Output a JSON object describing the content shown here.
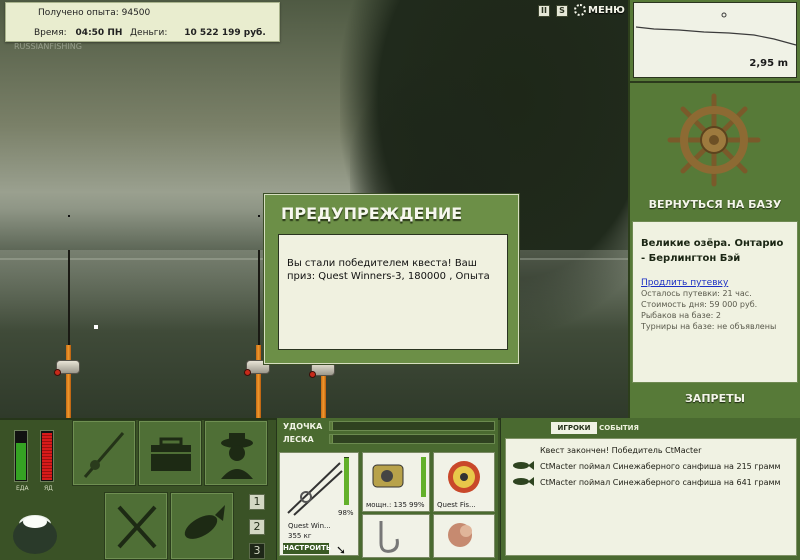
{
  "info": {
    "experience_label": "Получено опыта:",
    "experience_value": "94500",
    "time_label": "Время:",
    "time_value": "04:50 ПН",
    "money_label": "Деньги:",
    "money_value": "10 522 199 руб.",
    "logo_text": "RUSSIANFISHING"
  },
  "top_buttons": {
    "pause": "II",
    "sound": "S",
    "menu": "МЕНЮ"
  },
  "depth": {
    "value": "2,95 m"
  },
  "base": {
    "return_label": "ВЕРНУТЬСЯ НА БАЗУ",
    "location_title": "Великие озёра. Онтарио - Берлингтон Бэй",
    "extend_link": "Продлить путевку",
    "lines": [
      "Осталось путевки: 21 час.",
      "Стоимость дня: 59 000 руб.",
      "Рыбаков на базе: 2",
      "Турниры на базе: не объявлены"
    ],
    "bans_label": "ЗАПРЕТЫ"
  },
  "dialog": {
    "title": "ПРЕДУПРЕЖДЕНИЕ",
    "message": "Вы стали победителем квеста! Ваш приз: Quest Winners-3, 180000 , Опыта"
  },
  "status": {
    "food_label": "ЕДА",
    "poison_label": "ЯД",
    "food_level": 0.75,
    "poison_level": 0.95
  },
  "slots_numbers": [
    "1",
    "2",
    "3"
  ],
  "tackle": {
    "rod_label": "УДОЧКА",
    "line_label": "ЛЕСКА",
    "rod_tension": 0.02,
    "line_tension": 0.02,
    "rod_name": "Quest Win...",
    "rod_weight": "355 кг",
    "rod_durability": "98%",
    "rod_durability_level": 0.98,
    "reel_caption": "мощн.: 135",
    "reel_durability": "99%",
    "reel_durability_level": 0.99,
    "line_caption": "Quest Fis...",
    "setup_button": "НАСТРОИТЬ"
  },
  "events": {
    "tab_players": "ИГРОКИ",
    "tab_events": "СОБЫТИЯ",
    "rows": [
      "Квест закончен! Победитель CtMacter",
      "CtMacter поймал Синежаберного санфиша на 215 грамм",
      "CtMacter поймал Синежаберного санфиша на 641 грамм"
    ]
  },
  "colors": {
    "panel_green": "#577a38",
    "dialog_green": "#6c8f47",
    "rod_handle": "#f09a2e",
    "link_blue": "#1b2fc4"
  }
}
